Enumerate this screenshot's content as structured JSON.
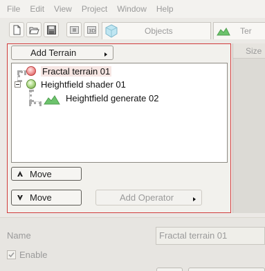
{
  "menu": [
    "File",
    "Edit",
    "View",
    "Project",
    "Window",
    "Help"
  ],
  "toolbar": {
    "buttons": [
      {
        "icon": "new-document-icon"
      },
      {
        "icon": "open-folder-icon"
      },
      {
        "icon": "save-icon"
      },
      {
        "icon": "render-icon"
      },
      {
        "icon": "3d-view-icon"
      }
    ],
    "tabs": [
      {
        "label": "Objects",
        "icon": "cube-icon"
      },
      {
        "label": "Ter",
        "icon": "terrain-icon"
      }
    ]
  },
  "panel": {
    "add_terrain_label": "Add Terrain",
    "tree": [
      {
        "label": "Fractal terrain 01",
        "icon": "red-sphere-icon",
        "selected": true
      },
      {
        "label": "Heightfield shader 01",
        "icon": "green-sphere-icon",
        "expanded": true
      },
      {
        "label": "Heightfield generate 02",
        "icon": "terrain-icon"
      }
    ],
    "move_up_label": "Move",
    "move_down_label": "Move",
    "add_operator_label": "Add Operator"
  },
  "right_pane": {
    "column_header": "Size"
  },
  "properties": {
    "name_label": "Name",
    "name_value": "Fractal terrain 01",
    "enable_label": "Enable",
    "enable_checked": true
  }
}
